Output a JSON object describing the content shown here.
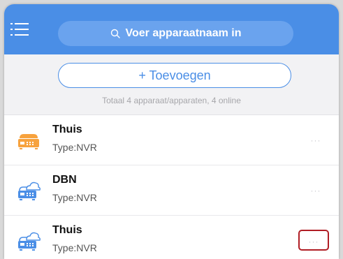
{
  "colors": {
    "topbar": "#4a8ee6",
    "accent": "#4a8ee6",
    "icon_orange": "#f7a23d",
    "icon_blue": "#4a8ee6",
    "highlight_border": "#b01d24"
  },
  "header": {
    "menu_icon": "hamburger-menu-icon",
    "search": {
      "icon": "search-icon",
      "placeholder": "Voer apparaatnaam in"
    }
  },
  "toolbar": {
    "add_label": "+ Toevoegen",
    "summary": "Totaal 4 apparaat/apparaten, 4 online"
  },
  "devices": [
    {
      "name": "Thuis",
      "type": "Type:NVR",
      "icon": "nvr-orange-icon",
      "more": "···"
    },
    {
      "name": "DBN",
      "type": "Type:NVR",
      "icon": "nvr-cloud-icon",
      "more": "···"
    },
    {
      "name": "Thuis",
      "type": "Type:NVR",
      "icon": "nvr-cloud-icon",
      "more": "···"
    }
  ]
}
